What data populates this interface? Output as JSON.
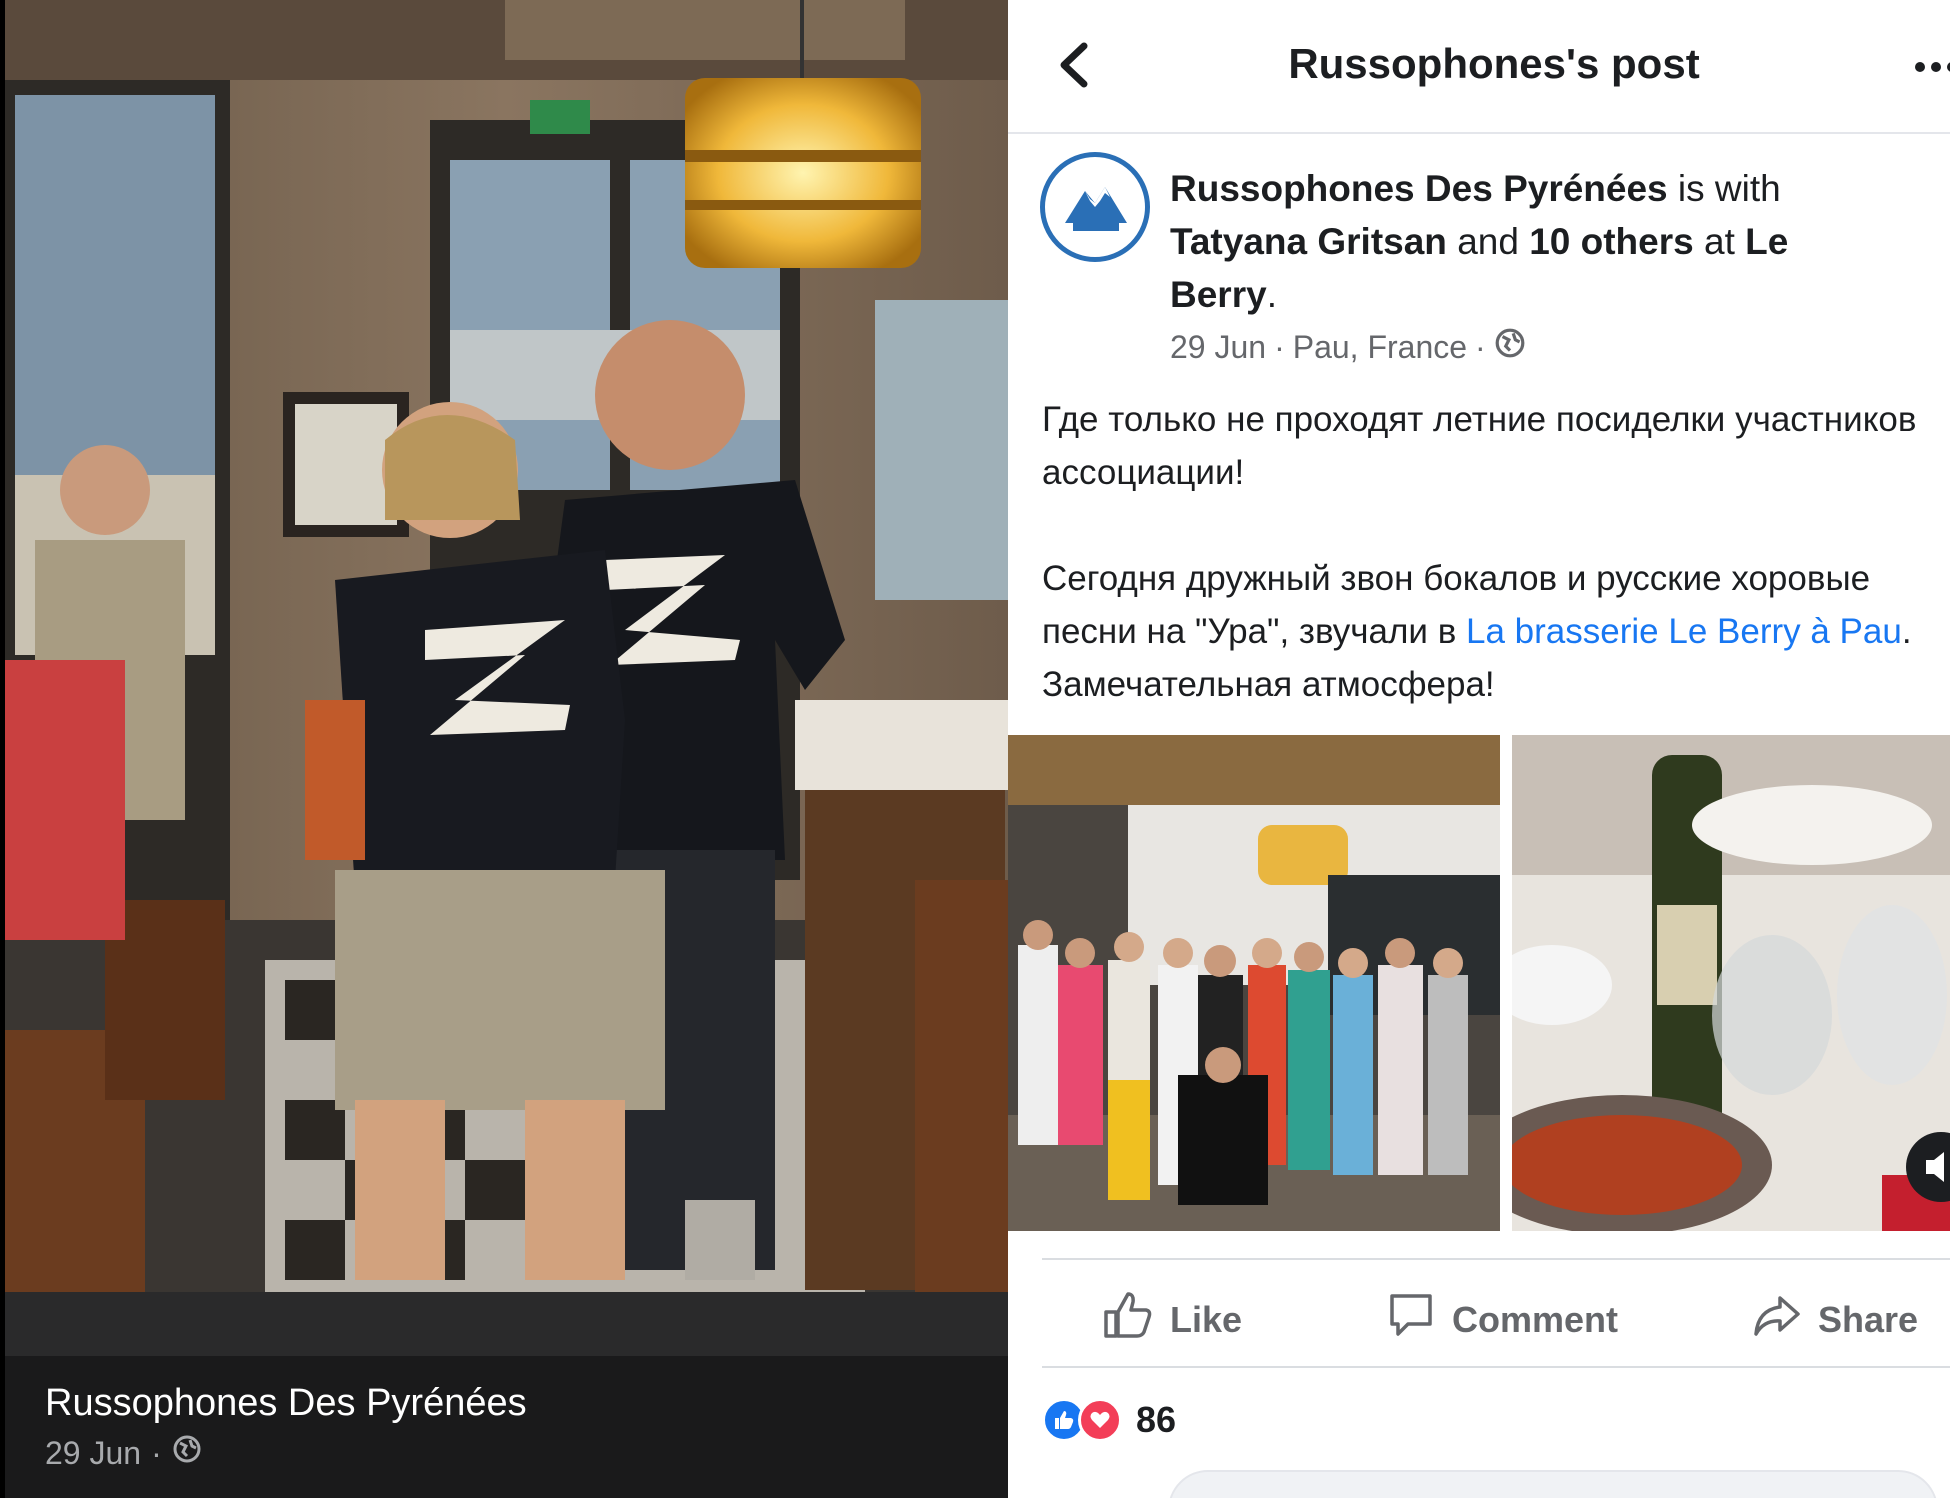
{
  "left_panel": {
    "author": "Russophones Des Pyrénées",
    "date": "29 Jun",
    "separator": "·",
    "privacy_icon": "globe-icon"
  },
  "right_panel": {
    "topbar": {
      "title": "Russophones's post",
      "back_icon": "chevron-left-icon",
      "more_icon": "more-icon"
    },
    "post": {
      "page_name": "Russophones Des Pyrénées",
      "is_with": "is with",
      "tagged_person": "Tatyana Gritsan",
      "and_text": "and",
      "others": "10 others",
      "at_text": "at",
      "place": "Le Berry",
      "period": ".",
      "date": "29 Jun",
      "dot": "·",
      "location": "Pau, France",
      "dot2": "·",
      "body_line1": "Где только не проходят летние посиделки участников ассоциации!",
      "body_line2_pre": "Сегодня дружный звон бокалов и русские хоровые песни на \"Ура\", звучали в",
      "body_link": "La brasserie Le Berry à Pau",
      "body_line2_post": ". Замечательная атмосфера!"
    },
    "actions": {
      "like": "Like",
      "comment": "Comment",
      "share": "Share"
    },
    "reactions": {
      "count": "86",
      "types": [
        "like",
        "love"
      ]
    }
  },
  "colors": {
    "link": "#1877f2",
    "secondary_text": "#65676b",
    "love": "#f33e58",
    "like": "#1877f2"
  }
}
